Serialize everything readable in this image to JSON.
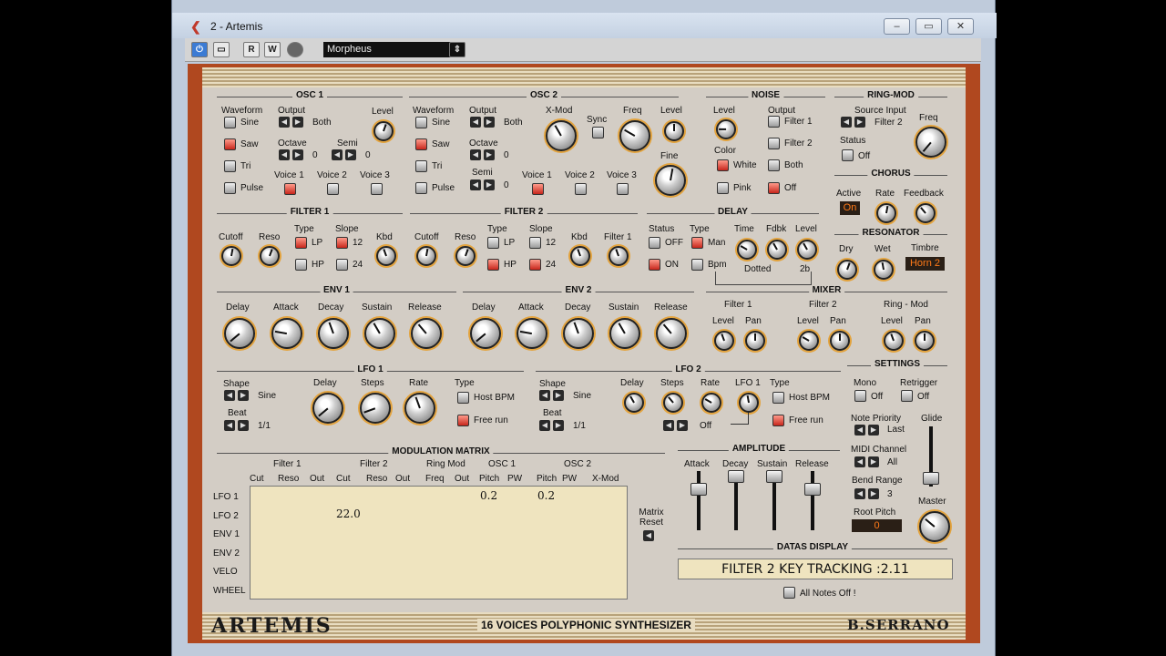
{
  "window": {
    "title": "2 - Artemis",
    "min": "▭",
    "max": "▭",
    "close": "✕"
  },
  "toolbar": {
    "power": "⏻",
    "b1": "▭",
    "read": "R",
    "write": "W",
    "preset": "Morpheus"
  },
  "osc1": {
    "title": "OSC 1",
    "waveform": "Waveform",
    "output": "Output",
    "output_val": "Both",
    "level": "Level",
    "sine": "Sine",
    "saw": "Saw",
    "tri": "Tri",
    "pulse": "Pulse",
    "octave": "Octave",
    "octave_val": "0",
    "semi": "Semi",
    "semi_val": "0",
    "voice1": "Voice 1",
    "voice2": "Voice 2",
    "voice3": "Voice 3"
  },
  "osc2": {
    "title": "OSC 2",
    "waveform": "Waveform",
    "output": "Output",
    "output_val": "Both",
    "xmod": "X-Mod",
    "freq": "Freq",
    "level": "Level",
    "sync": "Sync",
    "sine": "Sine",
    "saw": "Saw",
    "tri": "Tri",
    "pulse": "Pulse",
    "octave": "Octave",
    "octave_val": "0",
    "semi": "Semi",
    "semi_val": "0",
    "fine": "Fine",
    "voice1": "Voice 1",
    "voice2": "Voice 2",
    "voice3": "Voice 3"
  },
  "noise": {
    "title": "NOISE",
    "level": "Level",
    "output": "Output",
    "filter1": "Filter 1",
    "filter2": "Filter 2",
    "both": "Both",
    "off": "Off",
    "color": "Color",
    "white": "White",
    "pink": "Pink"
  },
  "ringmod": {
    "title": "RING-MOD",
    "source": "Source Input",
    "source_val": "Filter 2",
    "freq": "Freq",
    "status": "Status",
    "status_val": "Off"
  },
  "chorus": {
    "title": "CHORUS",
    "active": "Active",
    "active_val": "On",
    "rate": "Rate",
    "feedback": "Feedback"
  },
  "filter1": {
    "title": "FILTER 1",
    "cutoff": "Cutoff",
    "reso": "Reso",
    "type": "Type",
    "lp": "LP",
    "hp": "HP",
    "slope": "Slope",
    "s12": "12",
    "s24": "24",
    "kbd": "Kbd"
  },
  "filter2": {
    "title": "FILTER 2",
    "cutoff": "Cutoff",
    "reso": "Reso",
    "type": "Type",
    "lp": "LP",
    "hp": "HP",
    "slope": "Slope",
    "s12": "12",
    "s24": "24",
    "kbd": "Kbd",
    "filter1": "Filter 1"
  },
  "delay": {
    "title": "DELAY",
    "status": "Status",
    "off": "OFF",
    "on": "ON",
    "type": "Type",
    "man": "Man",
    "bpm": "Bpm",
    "time": "Time",
    "fdbk": "Fdbk",
    "level": "Level",
    "dotted": "Dotted",
    "twob": "2b"
  },
  "resonator": {
    "title": "RESONATOR",
    "dry": "Dry",
    "wet": "Wet",
    "timbre": "Timbre",
    "timbre_val": "Horn 2"
  },
  "env1": {
    "title": "ENV 1",
    "delay": "Delay",
    "attack": "Attack",
    "decay": "Decay",
    "sustain": "Sustain",
    "release": "Release"
  },
  "env2": {
    "title": "ENV 2",
    "delay": "Delay",
    "attack": "Attack",
    "decay": "Decay",
    "sustain": "Sustain",
    "release": "Release"
  },
  "mixer": {
    "title": "MIXER",
    "f1": "Filter 1",
    "f2": "Filter 2",
    "rm": "Ring - Mod",
    "level": "Level",
    "pan": "Pan"
  },
  "lfo1": {
    "title": "LFO 1",
    "shape": "Shape",
    "shape_val": "Sine",
    "beat": "Beat",
    "beat_val": "1/1",
    "delay": "Delay",
    "steps": "Steps",
    "rate": "Rate",
    "type": "Type",
    "host": "Host BPM",
    "free": "Free run"
  },
  "lfo2": {
    "title": "LFO 2",
    "shape": "Shape",
    "shape_val": "Sine",
    "beat": "Beat",
    "beat_val": "1/1",
    "delay": "Delay",
    "steps": "Steps",
    "rate": "Rate",
    "lfo1": "LFO 1",
    "type": "Type",
    "off": "Off",
    "host": "Host BPM",
    "free": "Free run"
  },
  "settings": {
    "title": "SETTINGS",
    "mono": "Mono",
    "mono_val": "Off",
    "retrig": "Retrigger",
    "retrig_val": "Off",
    "np": "Note Priority",
    "np_val": "Last",
    "glide": "Glide",
    "midi": "MIDI Channel",
    "midi_val": "All",
    "bend": "Bend Range",
    "bend_val": "3",
    "root": "Root Pitch",
    "root_val": "0",
    "master": "Master"
  },
  "matrix": {
    "title": "MODULATION MATRIX",
    "groups": [
      "Filter 1",
      "Filter 2",
      "Ring Mod",
      "OSC 1",
      "OSC 2"
    ],
    "cols": [
      "Cut",
      "Reso",
      "Out",
      "Cut",
      "Reso",
      "Out",
      "Freq",
      "Out",
      "Pitch",
      "PW",
      "Pitch",
      "PW",
      "X-Mod"
    ],
    "rows": [
      "LFO 1",
      "LFO 2",
      "ENV 1",
      "ENV 2",
      "VELO",
      "WHEEL"
    ],
    "v1": "0.2",
    "v2": "0.2",
    "v3": "22.0",
    "reset": "Matrix Reset"
  },
  "amplitude": {
    "title": "AMPLITUDE",
    "attack": "Attack",
    "decay": "Decay",
    "sustain": "Sustain",
    "release": "Release"
  },
  "datas": {
    "title": "DATAS DISPLAY",
    "text": "FILTER 2 KEY TRACKING :2.11",
    "allnotes": "All Notes Off !"
  },
  "footer": {
    "logo": "ARTEMIS",
    "tagline": "16 VOICES POLYPHONIC SYNTHESIZER",
    "brand": "B.SERRANO"
  }
}
